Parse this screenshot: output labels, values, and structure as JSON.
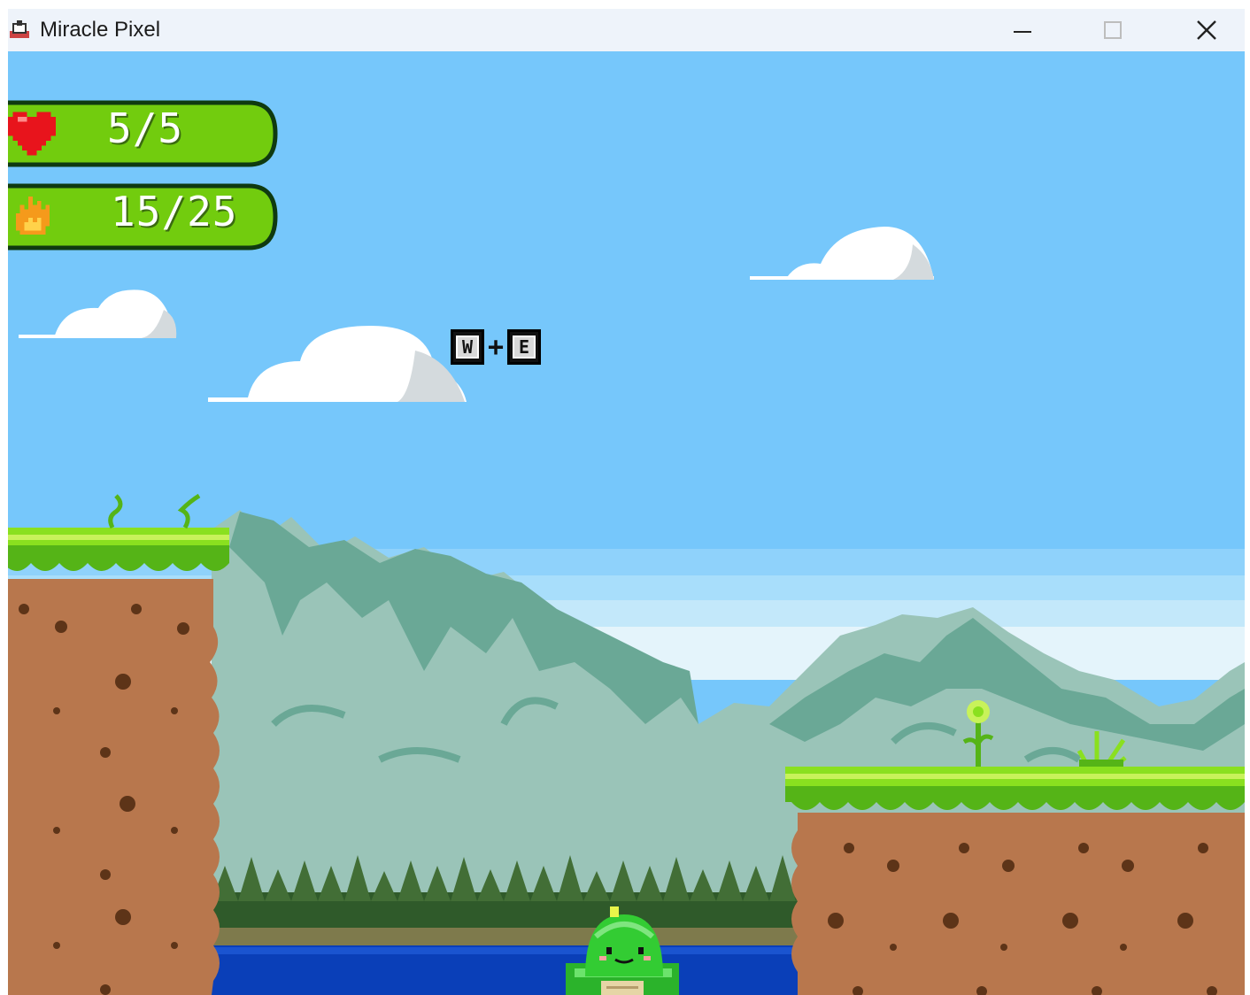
{
  "window": {
    "title": "Miracle Pixel",
    "controls": {
      "minimize": "minimize",
      "maximize": "maximize",
      "close": "close"
    }
  },
  "hud": {
    "health": {
      "icon": "heart-icon",
      "text": "5/5",
      "current": 5,
      "max": 5
    },
    "fire": {
      "icon": "fire-icon",
      "text": "15/25",
      "current": 15,
      "max": 25
    }
  },
  "key_hint": {
    "key1": "W",
    "plus": "+",
    "key2": "E"
  },
  "colors": {
    "sky": "#76c7fb",
    "grass": "#7bd41a",
    "dirt": "#b8774d",
    "water": "#0a3fb8",
    "mountain": "#8fc2b6",
    "hud_bar": "#72cc0e"
  }
}
